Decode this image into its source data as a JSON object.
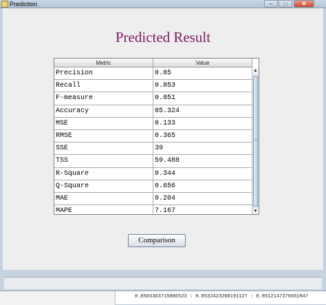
{
  "window": {
    "title": "Prediction"
  },
  "heading": "Predicted Result",
  "table": {
    "columns": [
      "Metric",
      "Value"
    ],
    "rows": [
      {
        "metric": "Precision",
        "value": "0.85"
      },
      {
        "metric": "Recall",
        "value": "0.853"
      },
      {
        "metric": "F-measure",
        "value": "0.851"
      },
      {
        "metric": "Accuracy",
        "value": "85.324"
      },
      {
        "metric": "MSE",
        "value": "0.133"
      },
      {
        "metric": "RMSE",
        "value": "0.365"
      },
      {
        "metric": "SSE",
        "value": "39"
      },
      {
        "metric": "TSS",
        "value": "59.488"
      },
      {
        "metric": "R-Square",
        "value": "0.344"
      },
      {
        "metric": "Q-Square",
        "value": "0.656"
      },
      {
        "metric": "MAE",
        "value": "0.204"
      },
      {
        "metric": "MAPE",
        "value": "7.167"
      }
    ]
  },
  "comparison_button": "Comparison",
  "console_output": "0.8503363715906523 : 0.8532423208191127 : 0.8512147376651947"
}
